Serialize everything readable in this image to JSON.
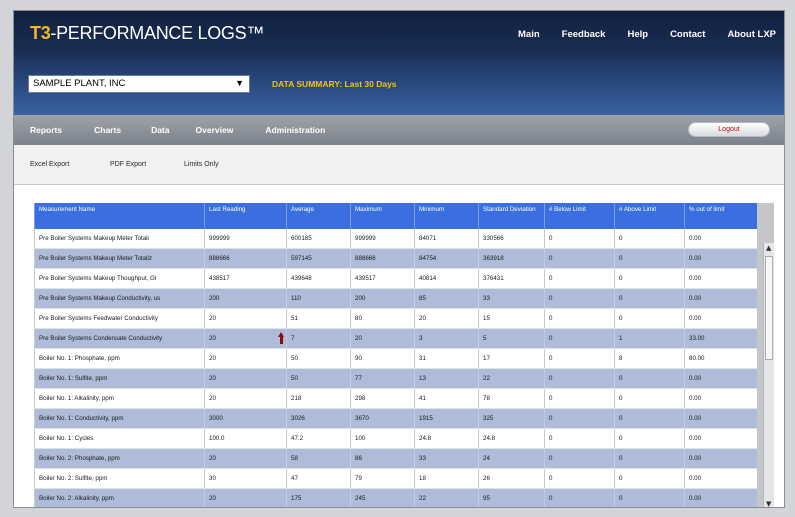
{
  "header": {
    "logo_accent": "T3",
    "logo_text": "-PERFORMANCE LOGS™",
    "nav": [
      "Main",
      "Feedback",
      "Help",
      "Contact",
      "About LXP"
    ]
  },
  "plantbar": {
    "plant_value": "SAMPLE PLANT, INC",
    "summary": "DATA SUMMARY: Last 30 Days"
  },
  "menu": {
    "items": [
      "Reports",
      "Charts",
      "Data",
      "Overview",
      "Administration"
    ],
    "logout": "Logout"
  },
  "toolbar": {
    "items": [
      "Excel Export",
      "PDF Export",
      "Limits Only"
    ]
  },
  "table": {
    "columns": [
      "Measurement Name",
      "Last Reading",
      "Average",
      "Maximum",
      "Minimum",
      "Standard Deviation",
      "# Below Limit",
      "# Above Limit",
      "% out of limit"
    ],
    "rows": [
      [
        "Pre Boiler Systems Makeup Meter Totali",
        "999999",
        "600185",
        "999999",
        "84071",
        "330566",
        "0",
        "0",
        "0.00"
      ],
      [
        "Pre Boiler Systems Makeup Meter Totaliz",
        "888666",
        "597145",
        "888666",
        "84754",
        "363918",
        "0",
        "0",
        "0.00"
      ],
      [
        "Pre Boiler Systems Makeup Thoughput, GI",
        "438517",
        "439648",
        "439517",
        "40814",
        "376431",
        "0",
        "0",
        "0.00"
      ],
      [
        "Pre Boiler Systems Makeup Conductivity, us",
        "200",
        "110",
        "200",
        "85",
        "33",
        "0",
        "0",
        "0.00"
      ],
      [
        "Pre Boiler Systems Feedwater Conductivity",
        "20",
        "51",
        "80",
        "20",
        "15",
        "0",
        "0",
        "0.00"
      ],
      [
        "Pre Boiler Systems Condensate Conductivity",
        "20",
        "7",
        "20",
        "3",
        "5",
        "0",
        "1",
        "33.00"
      ],
      [
        "Boiler No. 1: Phosphate, ppm",
        "20",
        "50",
        "90",
        "31",
        "17",
        "0",
        "8",
        "80.00"
      ],
      [
        "Boiler No. 1: Sulfite, ppm",
        "20",
        "50",
        "77",
        "13",
        "22",
        "0",
        "0",
        "0.00"
      ],
      [
        "Boiler No. 1: Alkalinity, ppm",
        "20",
        "218",
        "298",
        "41",
        "78",
        "0",
        "0",
        "0.00"
      ],
      [
        "Boiler No. 1: Conductivity, ppm",
        "3000",
        "3026",
        "3670",
        "1915",
        "325",
        "0",
        "0",
        "0.00"
      ],
      [
        "Boiler No. 1: Cycles",
        "100.0",
        "47.2",
        "100",
        "24.8",
        "24.8",
        "0",
        "0",
        "0.00"
      ],
      [
        "Boiler No. 2: Phosphate, ppm",
        "20",
        "58",
        "86",
        "33",
        "24",
        "0",
        "0",
        "0.00"
      ],
      [
        "Boiler No. 2: Sulfite, ppm",
        "30",
        "47",
        "79",
        "18",
        "26",
        "0",
        "0",
        "0.00"
      ],
      [
        "Boiler No. 2: Alkalinity, ppm",
        "20",
        "175",
        "245",
        "22",
        "95",
        "0",
        "0",
        "0.00"
      ]
    ]
  },
  "colors": {
    "header_bg": "#10203e",
    "accent": "#f7b528",
    "summary_text": "#f3c21a",
    "table_header": "#3a6ee1",
    "row_alt": "#aebbd9",
    "alert": "#8b0e0e"
  },
  "icons": {
    "dropdown": "chevron-down-icon",
    "alert": "arrow-up-icon",
    "scroll_up": "chevron-up-icon",
    "scroll_down": "chevron-down-icon"
  }
}
